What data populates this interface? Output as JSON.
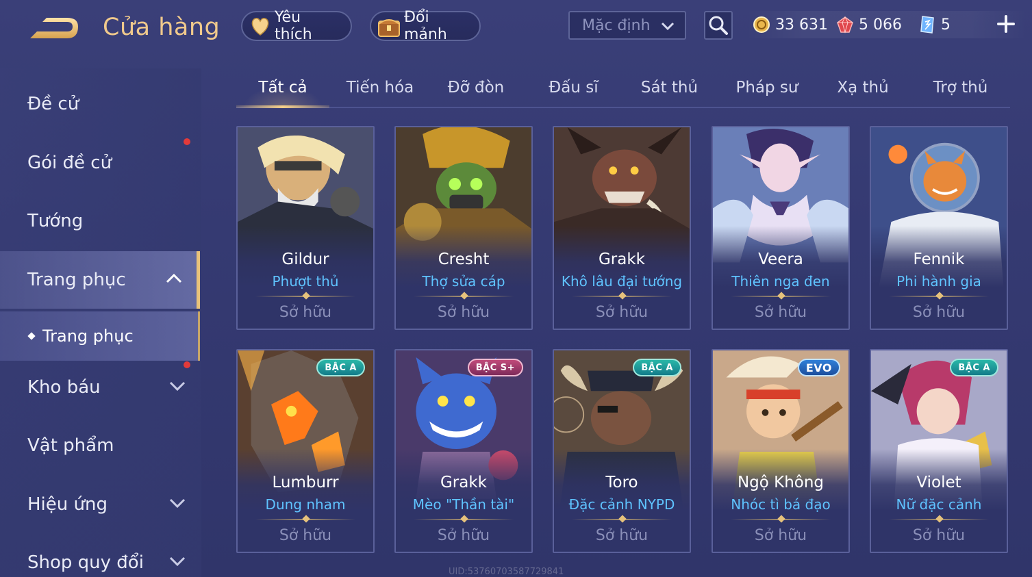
{
  "header": {
    "title": "Cửa hàng",
    "favorite_label": "Yêu thích",
    "shard_label": "Đổi mảnh",
    "sort_value": "Mặc định",
    "currencies": {
      "gold": "33 631",
      "ruby": "5 066",
      "voucher": "5"
    }
  },
  "sidebar": {
    "items": [
      {
        "label": "Đề cử"
      },
      {
        "label": "Gói đề cử"
      },
      {
        "label": "Tướng"
      },
      {
        "label": "Trang phục"
      },
      {
        "label": "Kho báu"
      },
      {
        "label": "Vật phẩm"
      },
      {
        "label": "Hiệu ứng"
      },
      {
        "label": "Shop quy đổi"
      }
    ],
    "sub_item": "Trang phục"
  },
  "tabs": [
    "Tất cả",
    "Tiến hóa",
    "Đỡ đòn",
    "Đấu sĩ",
    "Sát thủ",
    "Pháp sư",
    "Xạ thủ",
    "Trợ thủ"
  ],
  "cards": [
    {
      "hero": "Gildur",
      "skin": "Phượt thủ",
      "status": "Sở hữu",
      "badge": ""
    },
    {
      "hero": "Cresht",
      "skin": "Thợ sửa cáp",
      "status": "Sở hữu",
      "badge": ""
    },
    {
      "hero": "Grakk",
      "skin": "Khô lâu đại tướng",
      "status": "Sở hữu",
      "badge": ""
    },
    {
      "hero": "Veera",
      "skin": "Thiên nga đen",
      "status": "Sở hữu",
      "badge": ""
    },
    {
      "hero": "Fennik",
      "skin": "Phi hành gia",
      "status": "Sở hữu",
      "badge": ""
    },
    {
      "hero": "Lumburr",
      "skin": "Dung nham",
      "status": "Sở hữu",
      "badge": "BẬC A"
    },
    {
      "hero": "Grakk",
      "skin": "Mèo \"Thần tài\"",
      "status": "Sở hữu",
      "badge": "BẬC S+"
    },
    {
      "hero": "Toro",
      "skin": "Đặc cảnh NYPD",
      "status": "Sở hữu",
      "badge": "BẬC A"
    },
    {
      "hero": "Ngộ Không",
      "skin": "Nhóc tì bá đạo",
      "status": "Sở hữu",
      "badge": "EVO"
    },
    {
      "hero": "Violet",
      "skin": "Nữ đặc cảnh",
      "status": "Sở hữu",
      "badge": "BẬC A"
    }
  ],
  "uid_text": "UID:53760703587729841",
  "colors": {
    "accent_gold": "#f0c98c",
    "skin_blue": "#5fc3ff",
    "notify_red": "#e23a3a"
  }
}
